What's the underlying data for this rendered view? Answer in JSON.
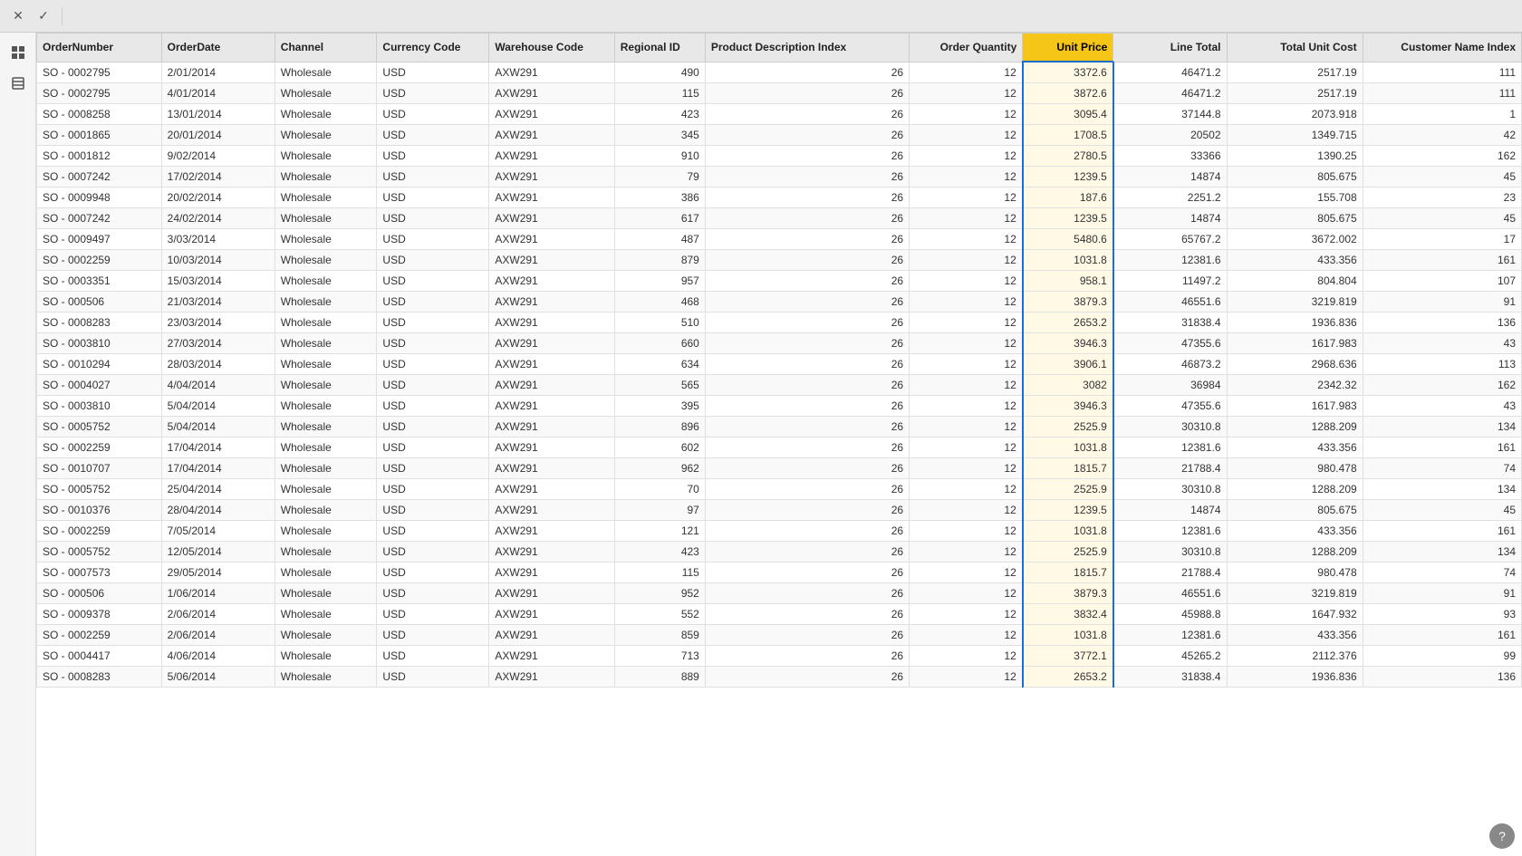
{
  "toolbar": {
    "close_icon": "✕",
    "check_icon": "✓"
  },
  "left_panel": {
    "icons": [
      "grid",
      "layers"
    ]
  },
  "table": {
    "columns": [
      {
        "id": "OrderNumber",
        "label": "OrderNumber",
        "active": false
      },
      {
        "id": "OrderDate",
        "label": "OrderDate",
        "active": false
      },
      {
        "id": "Channel",
        "label": "Channel",
        "active": false
      },
      {
        "id": "CurrencyCode",
        "label": "Currency Code",
        "active": false
      },
      {
        "id": "WarehouseCode",
        "label": "Warehouse Code",
        "active": false
      },
      {
        "id": "RegionalID",
        "label": "Regional ID",
        "active": false
      },
      {
        "id": "ProductDescriptionIndex",
        "label": "Product Description Index",
        "active": false
      },
      {
        "id": "OrderQuantity",
        "label": "Order Quantity",
        "active": false
      },
      {
        "id": "UnitPrice",
        "label": "Unit Price",
        "active": true
      },
      {
        "id": "LineTotal",
        "label": "Line Total",
        "active": false
      },
      {
        "id": "TotalUnitCost",
        "label": "Total Unit Cost",
        "active": false
      },
      {
        "id": "CustomerNameIndex",
        "label": "Customer Name Index",
        "active": false
      }
    ],
    "rows": [
      [
        "SO - 0002795",
        "2/01/2014",
        "Wholesale",
        "USD",
        "AXW291",
        "490",
        "26",
        "12",
        "3372.6",
        "46471.2",
        "2517.19",
        "111"
      ],
      [
        "SO - 0002795",
        "4/01/2014",
        "Wholesale",
        "USD",
        "AXW291",
        "115",
        "26",
        "12",
        "3872.6",
        "46471.2",
        "2517.19",
        "111"
      ],
      [
        "SO - 0008258",
        "13/01/2014",
        "Wholesale",
        "USD",
        "AXW291",
        "423",
        "26",
        "12",
        "3095.4",
        "37144.8",
        "2073.918",
        "1"
      ],
      [
        "SO - 0001865",
        "20/01/2014",
        "Wholesale",
        "USD",
        "AXW291",
        "345",
        "26",
        "12",
        "1708.5",
        "20502",
        "1349.715",
        "42"
      ],
      [
        "SO - 0001812",
        "9/02/2014",
        "Wholesale",
        "USD",
        "AXW291",
        "910",
        "26",
        "12",
        "2780.5",
        "33366",
        "1390.25",
        "162"
      ],
      [
        "SO - 0007242",
        "17/02/2014",
        "Wholesale",
        "USD",
        "AXW291",
        "79",
        "26",
        "12",
        "1239.5",
        "14874",
        "805.675",
        "45"
      ],
      [
        "SO - 0009948",
        "20/02/2014",
        "Wholesale",
        "USD",
        "AXW291",
        "386",
        "26",
        "12",
        "187.6",
        "2251.2",
        "155.708",
        "23"
      ],
      [
        "SO - 0007242",
        "24/02/2014",
        "Wholesale",
        "USD",
        "AXW291",
        "617",
        "26",
        "12",
        "1239.5",
        "14874",
        "805.675",
        "45"
      ],
      [
        "SO - 0009497",
        "3/03/2014",
        "Wholesale",
        "USD",
        "AXW291",
        "487",
        "26",
        "12",
        "5480.6",
        "65767.2",
        "3672.002",
        "17"
      ],
      [
        "SO - 0002259",
        "10/03/2014",
        "Wholesale",
        "USD",
        "AXW291",
        "879",
        "26",
        "12",
        "1031.8",
        "12381.6",
        "433.356",
        "161"
      ],
      [
        "SO - 0003351",
        "15/03/2014",
        "Wholesale",
        "USD",
        "AXW291",
        "957",
        "26",
        "12",
        "958.1",
        "11497.2",
        "804.804",
        "107"
      ],
      [
        "SO - 000506",
        "21/03/2014",
        "Wholesale",
        "USD",
        "AXW291",
        "468",
        "26",
        "12",
        "3879.3",
        "46551.6",
        "3219.819",
        "91"
      ],
      [
        "SO - 0008283",
        "23/03/2014",
        "Wholesale",
        "USD",
        "AXW291",
        "510",
        "26",
        "12",
        "2653.2",
        "31838.4",
        "1936.836",
        "136"
      ],
      [
        "SO - 0003810",
        "27/03/2014",
        "Wholesale",
        "USD",
        "AXW291",
        "660",
        "26",
        "12",
        "3946.3",
        "47355.6",
        "1617.983",
        "43"
      ],
      [
        "SO - 0010294",
        "28/03/2014",
        "Wholesale",
        "USD",
        "AXW291",
        "634",
        "26",
        "12",
        "3906.1",
        "46873.2",
        "2968.636",
        "113"
      ],
      [
        "SO - 0004027",
        "4/04/2014",
        "Wholesale",
        "USD",
        "AXW291",
        "565",
        "26",
        "12",
        "3082",
        "36984",
        "2342.32",
        "162"
      ],
      [
        "SO - 0003810",
        "5/04/2014",
        "Wholesale",
        "USD",
        "AXW291",
        "395",
        "26",
        "12",
        "3946.3",
        "47355.6",
        "1617.983",
        "43"
      ],
      [
        "SO - 0005752",
        "5/04/2014",
        "Wholesale",
        "USD",
        "AXW291",
        "896",
        "26",
        "12",
        "2525.9",
        "30310.8",
        "1288.209",
        "134"
      ],
      [
        "SO - 0002259",
        "17/04/2014",
        "Wholesale",
        "USD",
        "AXW291",
        "602",
        "26",
        "12",
        "1031.8",
        "12381.6",
        "433.356",
        "161"
      ],
      [
        "SO - 0010707",
        "17/04/2014",
        "Wholesale",
        "USD",
        "AXW291",
        "962",
        "26",
        "12",
        "1815.7",
        "21788.4",
        "980.478",
        "74"
      ],
      [
        "SO - 0005752",
        "25/04/2014",
        "Wholesale",
        "USD",
        "AXW291",
        "70",
        "26",
        "12",
        "2525.9",
        "30310.8",
        "1288.209",
        "134"
      ],
      [
        "SO - 0010376",
        "28/04/2014",
        "Wholesale",
        "USD",
        "AXW291",
        "97",
        "26",
        "12",
        "1239.5",
        "14874",
        "805.675",
        "45"
      ],
      [
        "SO - 0002259",
        "7/05/2014",
        "Wholesale",
        "USD",
        "AXW291",
        "121",
        "26",
        "12",
        "1031.8",
        "12381.6",
        "433.356",
        "161"
      ],
      [
        "SO - 0005752",
        "12/05/2014",
        "Wholesale",
        "USD",
        "AXW291",
        "423",
        "26",
        "12",
        "2525.9",
        "30310.8",
        "1288.209",
        "134"
      ],
      [
        "SO - 0007573",
        "29/05/2014",
        "Wholesale",
        "USD",
        "AXW291",
        "115",
        "26",
        "12",
        "1815.7",
        "21788.4",
        "980.478",
        "74"
      ],
      [
        "SO - 000506",
        "1/06/2014",
        "Wholesale",
        "USD",
        "AXW291",
        "952",
        "26",
        "12",
        "3879.3",
        "46551.6",
        "3219.819",
        "91"
      ],
      [
        "SO - 0009378",
        "2/06/2014",
        "Wholesale",
        "USD",
        "AXW291",
        "552",
        "26",
        "12",
        "3832.4",
        "45988.8",
        "1647.932",
        "93"
      ],
      [
        "SO - 0002259",
        "2/06/2014",
        "Wholesale",
        "USD",
        "AXW291",
        "859",
        "26",
        "12",
        "1031.8",
        "12381.6",
        "433.356",
        "161"
      ],
      [
        "SO - 0004417",
        "4/06/2014",
        "Wholesale",
        "USD",
        "AXW291",
        "713",
        "26",
        "12",
        "3772.1",
        "45265.2",
        "2112.376",
        "99"
      ],
      [
        "SO - 0008283",
        "5/06/2014",
        "Wholesale",
        "USD",
        "AXW291",
        "889",
        "26",
        "12",
        "2653.2",
        "31838.4",
        "1936.836",
        "136"
      ]
    ]
  }
}
